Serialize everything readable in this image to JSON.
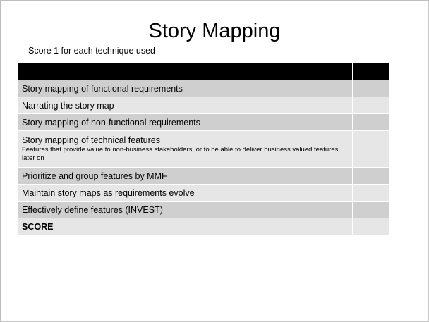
{
  "slide": {
    "title": "Story Mapping",
    "subtitle": "Score 1 for each technique used"
  },
  "table": {
    "rows": [
      {
        "label": "Story mapping of functional requirements"
      },
      {
        "label": "Narrating the story map"
      },
      {
        "label": "Story mapping of non-functional requirements"
      },
      {
        "label": "Story mapping of technical features",
        "detail": "Features that provide value to non-business stakeholders, or to be able to deliver business valued features later on"
      },
      {
        "label": "Prioritize and group  features by MMF"
      },
      {
        "label": "Maintain story maps as requirements evolve"
      },
      {
        "label": "Effectively define features (INVEST)"
      }
    ],
    "total_label": "SCORE"
  },
  "colors": {
    "header": "#000000",
    "row_dark": "#cfcfcf",
    "row_light": "#e6e6e6"
  }
}
